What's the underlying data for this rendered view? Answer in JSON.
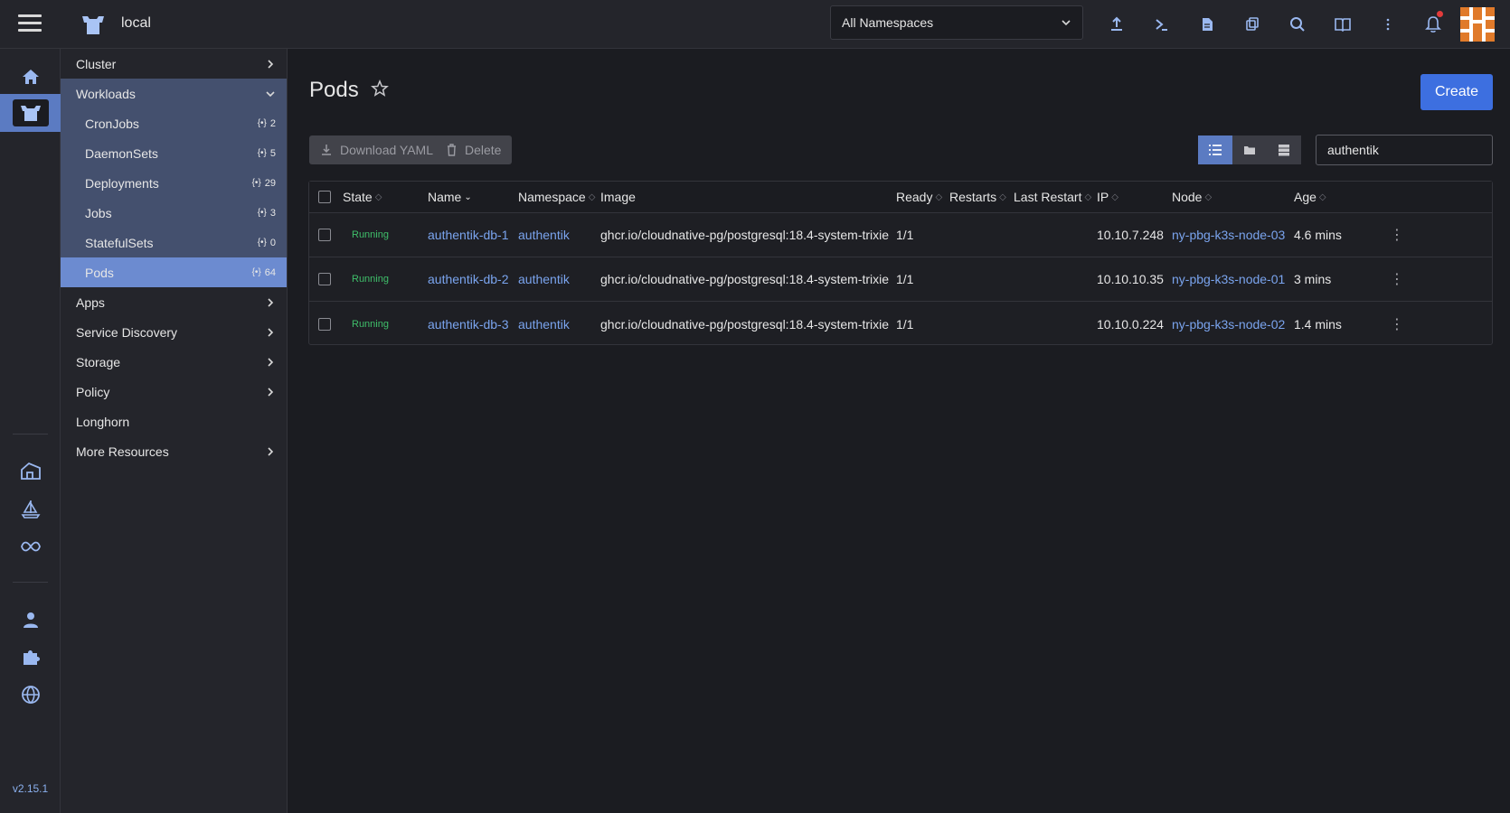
{
  "header": {
    "cluster_name": "local",
    "namespace_select": "All Namespaces",
    "icons": [
      "import-yaml-icon",
      "kubectl-shell-icon",
      "kubeconfig-icon",
      "copy-kubeconfig-icon",
      "resource-search-icon",
      "docs-icon",
      "more-icon",
      "notifications-icon"
    ]
  },
  "rail": {
    "version": "v2.15.1",
    "icons": [
      "home-icon",
      "cluster-icon",
      "fleet-icon",
      "extensions-helm-icon",
      "harvester-icon",
      "users-icon",
      "extensions-icon",
      "global-settings-icon"
    ]
  },
  "sidenav": {
    "items": [
      {
        "label": "Cluster",
        "chevron": "right"
      },
      {
        "label": "Workloads",
        "chevron": "down"
      },
      {
        "label": "CronJobs",
        "count": "2"
      },
      {
        "label": "DaemonSets",
        "count": "5"
      },
      {
        "label": "Deployments",
        "count": "29"
      },
      {
        "label": "Jobs",
        "count": "3"
      },
      {
        "label": "StatefulSets",
        "count": "0"
      },
      {
        "label": "Pods",
        "count": "64"
      },
      {
        "label": "Apps",
        "chevron": "right"
      },
      {
        "label": "Service Discovery",
        "chevron": "right"
      },
      {
        "label": "Storage",
        "chevron": "right"
      },
      {
        "label": "Policy",
        "chevron": "right"
      },
      {
        "label": "Longhorn"
      },
      {
        "label": "More Resources",
        "chevron": "right"
      }
    ]
  },
  "main": {
    "title": "Pods",
    "create_label": "Create",
    "download_yaml_label": "Download YAML",
    "delete_label": "Delete",
    "search_value": "authentik",
    "columns": [
      "State",
      "Name",
      "Namespace",
      "Image",
      "Ready",
      "Restarts",
      "Last Restart",
      "IP",
      "Node",
      "Age"
    ],
    "rows": [
      {
        "state": "Running",
        "name": "authentik-db-1",
        "namespace": "authentik",
        "image": "ghcr.io/cloudnative-pg/postgresql:18.4-system-trixie",
        "ready": "1/1",
        "restarts": "",
        "last_restart": "",
        "ip": "10.10.7.248",
        "node": "ny-pbg-k3s-node-03",
        "age": "4.6 mins"
      },
      {
        "state": "Running",
        "name": "authentik-db-2",
        "namespace": "authentik",
        "image": "ghcr.io/cloudnative-pg/postgresql:18.4-system-trixie",
        "ready": "1/1",
        "restarts": "",
        "last_restart": "",
        "ip": "10.10.10.35",
        "node": "ny-pbg-k3s-node-01",
        "age": "3 mins"
      },
      {
        "state": "Running",
        "name": "authentik-db-3",
        "namespace": "authentik",
        "image": "ghcr.io/cloudnative-pg/postgresql:18.4-system-trixie",
        "ready": "1/1",
        "restarts": "",
        "last_restart": "",
        "ip": "10.10.0.224",
        "node": "ny-pbg-k3s-node-02",
        "age": "1.4 mins"
      }
    ]
  },
  "colors": {
    "accent": "#3d6fe0",
    "link": "#7aa4ee",
    "running": "#3fbf6a",
    "nav_selected": "#6c8bd0",
    "nav_group": "#44506e"
  }
}
